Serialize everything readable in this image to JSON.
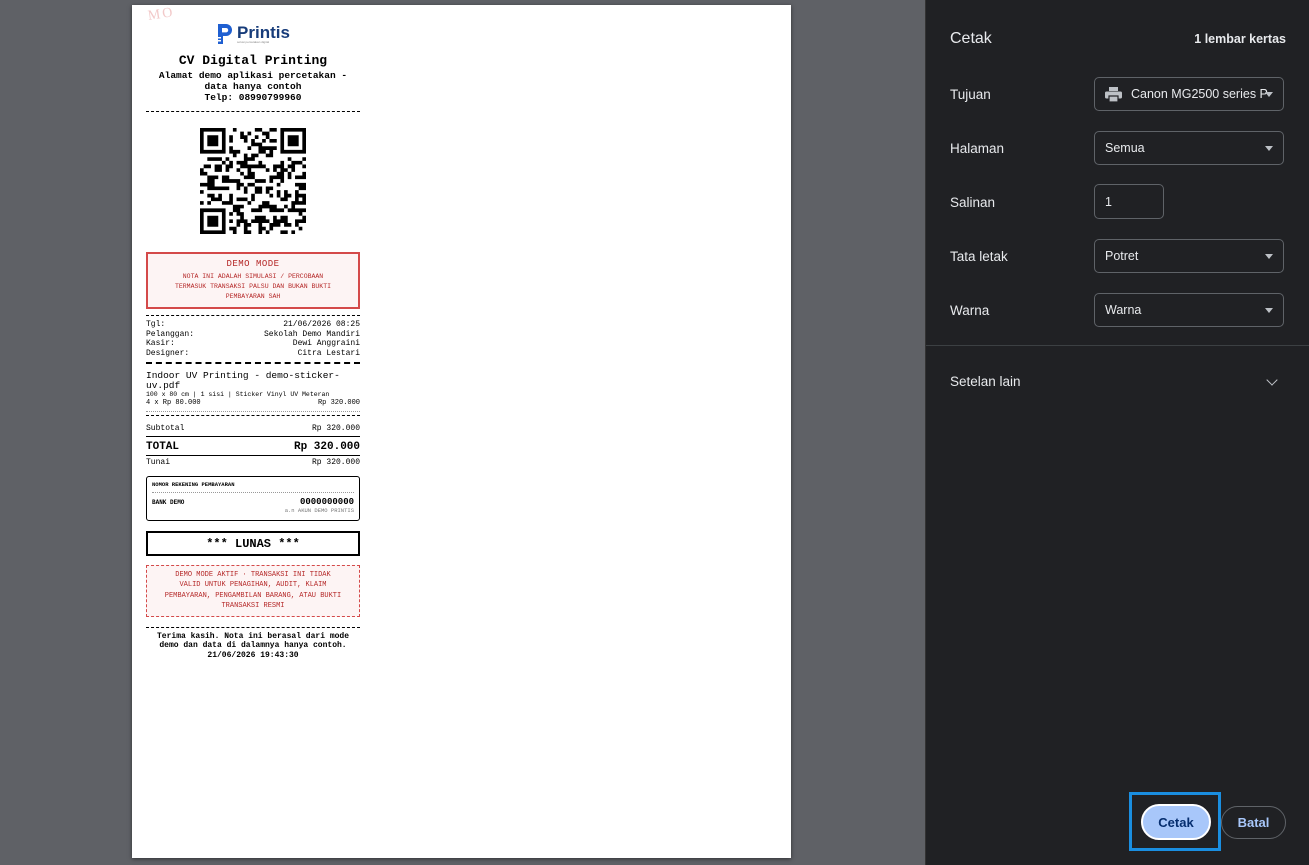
{
  "receipt": {
    "logo_name": "Printis",
    "logo_tagline": "solusi percetakan digital",
    "watermark": "MO",
    "shop_name": "CV Digital Printing",
    "address_line1": "Alamat demo aplikasi percetakan -",
    "address_line2": "data hanya contoh",
    "phone": "Telp: 08990799960",
    "demo_title": "DEMO MODE",
    "demo_text1": "NOTA INI ADALAH SIMULASI / PERCOBAAN",
    "demo_text2": "TERMASUK TRANSAKSI PALSU DAN BUKAN BUKTI",
    "demo_text3": "PEMBAYARAN SAH",
    "meta": [
      {
        "label": "Tgl:",
        "value": "21/06/2026 08:25"
      },
      {
        "label": "Pelanggan:",
        "value": "Sekolah Demo Mandiri"
      },
      {
        "label": "Kasir:",
        "value": "Dewi Anggraini"
      },
      {
        "label": "Designer:",
        "value": "Citra Lestari"
      }
    ],
    "item_name": "Indoor UV Printing - demo-sticker-uv.pdf",
    "item_desc": "100 x 80 cm | 1 sisi | Sticker Vinyl UV Meteran",
    "item_qty": "4 x Rp 80.000",
    "item_amount": "Rp 320.000",
    "subtotal_label": "Subtotal",
    "subtotal_value": "Rp 320.000",
    "total_label": "TOTAL",
    "total_value": "Rp 320.000",
    "paid_label": "Tunai",
    "paid_value": "Rp 320.000",
    "bank_header": "NOMOR REKENING PEMBAYARAN",
    "bank_name": "BANK DEMO",
    "bank_number": "0000000000",
    "bank_owner": "a.n AKUN DEMO PRINTIS",
    "status": "*** LUNAS ***",
    "demo_footer1": "DEMO MODE AKTIF · TRANSAKSI INI TIDAK",
    "demo_footer2": "VALID UNTUK PENAGIHAN, AUDIT, KLAIM",
    "demo_footer3": "PEMBAYARAN, PENGAMBILAN BARANG, ATAU BUKTI",
    "demo_footer4": "TRANSAKSI RESMI",
    "thanks1": "Terima kasih. Nota ini berasal dari mode",
    "thanks2": "demo dan data di dalamnya hanya contoh.",
    "printed_at": "21/06/2026 19:43:30"
  },
  "panel": {
    "title": "Cetak",
    "sheet_count": "1 lembar kertas",
    "destination_label": "Tujuan",
    "destination_value": "Canon MG2500 series P",
    "destination_icon": "printer-icon",
    "pages_label": "Halaman",
    "pages_value": "Semua",
    "copies_label": "Salinan",
    "copies_value": "1",
    "layout_label": "Tata letak",
    "layout_value": "Potret",
    "color_label": "Warna",
    "color_value": "Warna",
    "more_settings": "Setelan lain",
    "print_button": "Cetak",
    "cancel_button": "Batal"
  },
  "colors": {
    "panel_bg": "#202124",
    "preview_bg": "#5f6166",
    "accent": "#a8c7fa",
    "focus_ring": "#1a8ee0",
    "demo_red": "#b52828"
  }
}
